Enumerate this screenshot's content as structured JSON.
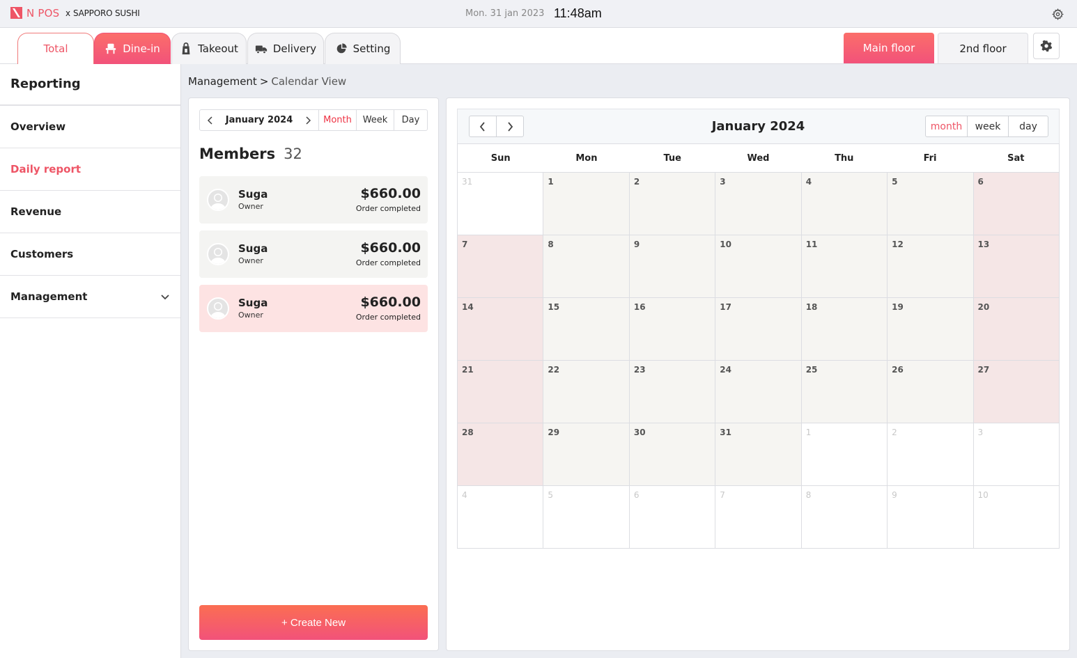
{
  "header": {
    "brand": "N POS",
    "brand_x": "x",
    "restaurant": "SAPPORO SUSHI",
    "date": "Mon. 31 jan 2023",
    "time": "11:48am",
    "settings_icon": "gear-icon"
  },
  "tabs": [
    {
      "label": "Total",
      "icon": ""
    },
    {
      "label": "Dine-in",
      "icon": "chair-icon"
    },
    {
      "label": "Takeout",
      "icon": "bag-icon"
    },
    {
      "label": "Delivery",
      "icon": "truck-icon"
    },
    {
      "label": "Setting",
      "icon": "pie-chart-icon"
    }
  ],
  "floors": {
    "main": "Main floor",
    "second": "2nd floor"
  },
  "sidebar": {
    "title": "Reporting",
    "items": [
      {
        "label": "Overview"
      },
      {
        "label": "Daily report"
      },
      {
        "label": "Revenue"
      },
      {
        "label": "Customers"
      },
      {
        "label": "Management"
      }
    ]
  },
  "breadcrumb": {
    "parent": "Management",
    "separator": ">",
    "current": "Calendar View"
  },
  "members_panel": {
    "month_label": "January 2024",
    "views": [
      "Month",
      "Week",
      "Day"
    ],
    "title": "Members",
    "count": "32",
    "members": [
      {
        "name": "Suga",
        "role": "Owner",
        "amount": "$660.00",
        "status": "Order completed"
      },
      {
        "name": "Suga",
        "role": "Owner",
        "amount": "$660.00",
        "status": "Order completed"
      },
      {
        "name": "Suga",
        "role": "Owner",
        "amount": "$660.00",
        "status": "Order completed"
      }
    ],
    "create_label": "+ Create New"
  },
  "calendar": {
    "title": "January 2024",
    "views": [
      "month",
      "week",
      "day"
    ],
    "weekdays": [
      "Sun",
      "Mon",
      "Tue",
      "Wed",
      "Thu",
      "Fri",
      "Sat"
    ],
    "weeks": [
      [
        "31",
        "1",
        "2",
        "3",
        "4",
        "5",
        "6"
      ],
      [
        "7",
        "8",
        "9",
        "10",
        "11",
        "12",
        "13"
      ],
      [
        "14",
        "15",
        "16",
        "17",
        "18",
        "19",
        "20"
      ],
      [
        "21",
        "22",
        "23",
        "24",
        "25",
        "26",
        "27"
      ],
      [
        "28",
        "29",
        "30",
        "31",
        "1",
        "2",
        "3"
      ],
      [
        "4",
        "5",
        "6",
        "7",
        "8",
        "9",
        "10"
      ]
    ]
  },
  "colors": {
    "accent": "#ee5566",
    "weekend_bg": "#f5e6e6",
    "day_bg": "#f6f5f2"
  }
}
